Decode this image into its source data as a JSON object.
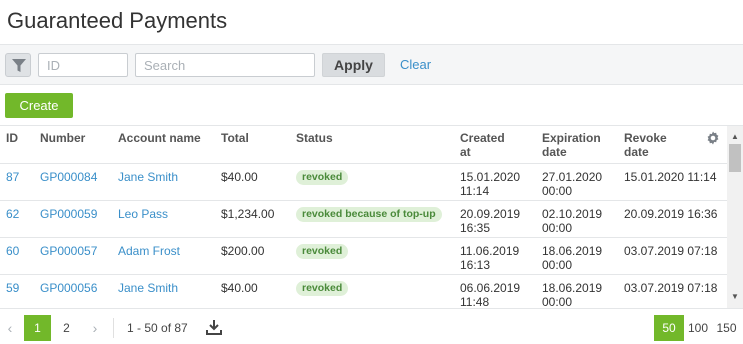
{
  "page": {
    "title": "Guaranteed Payments"
  },
  "filters": {
    "id_placeholder": "ID",
    "search_placeholder": "Search",
    "apply_label": "Apply",
    "clear_label": "Clear"
  },
  "actions": {
    "create_label": "Create"
  },
  "table": {
    "columns": {
      "id": "ID",
      "number": "Number",
      "account": "Account name",
      "total": "Total",
      "status": "Status",
      "created": [
        "Created",
        "at"
      ],
      "expiration": [
        "Expiration",
        "date"
      ],
      "revoke": [
        "Revoke",
        "date"
      ]
    },
    "rows": [
      {
        "id": "87",
        "number": "GP000084",
        "account": "Jane Smith",
        "total": "$40.00",
        "status": "revoked",
        "created": [
          "15.01.2020",
          "11:14"
        ],
        "expiration": [
          "27.01.2020",
          "00:00"
        ],
        "revoke": "15.01.2020 11:14"
      },
      {
        "id": "62",
        "number": "GP000059",
        "account": "Leo Pass",
        "total": "$1,234.00",
        "status": "revoked because of top-up",
        "created": [
          "20.09.2019",
          "16:35"
        ],
        "expiration": [
          "02.10.2019",
          "00:00"
        ],
        "revoke": "20.09.2019 16:36"
      },
      {
        "id": "60",
        "number": "GP000057",
        "account": "Adam Frost",
        "total": "$200.00",
        "status": "revoked",
        "created": [
          "11.06.2019",
          "16:13"
        ],
        "expiration": [
          "18.06.2019",
          "00:00"
        ],
        "revoke": "03.07.2019 07:18"
      },
      {
        "id": "59",
        "number": "GP000056",
        "account": "Jane Smith",
        "total": "$40.00",
        "status": "revoked",
        "created": [
          "06.06.2019",
          "11:48"
        ],
        "expiration": [
          "18.06.2019",
          "00:00"
        ],
        "revoke": "03.07.2019 07:18"
      }
    ]
  },
  "pagination": {
    "prev": "‹",
    "next": "›",
    "pages": [
      "1",
      "2"
    ],
    "current_page": "1",
    "range": "1 - 50 of 87",
    "page_sizes": [
      "50",
      "100",
      "150"
    ],
    "current_size": "50"
  }
}
